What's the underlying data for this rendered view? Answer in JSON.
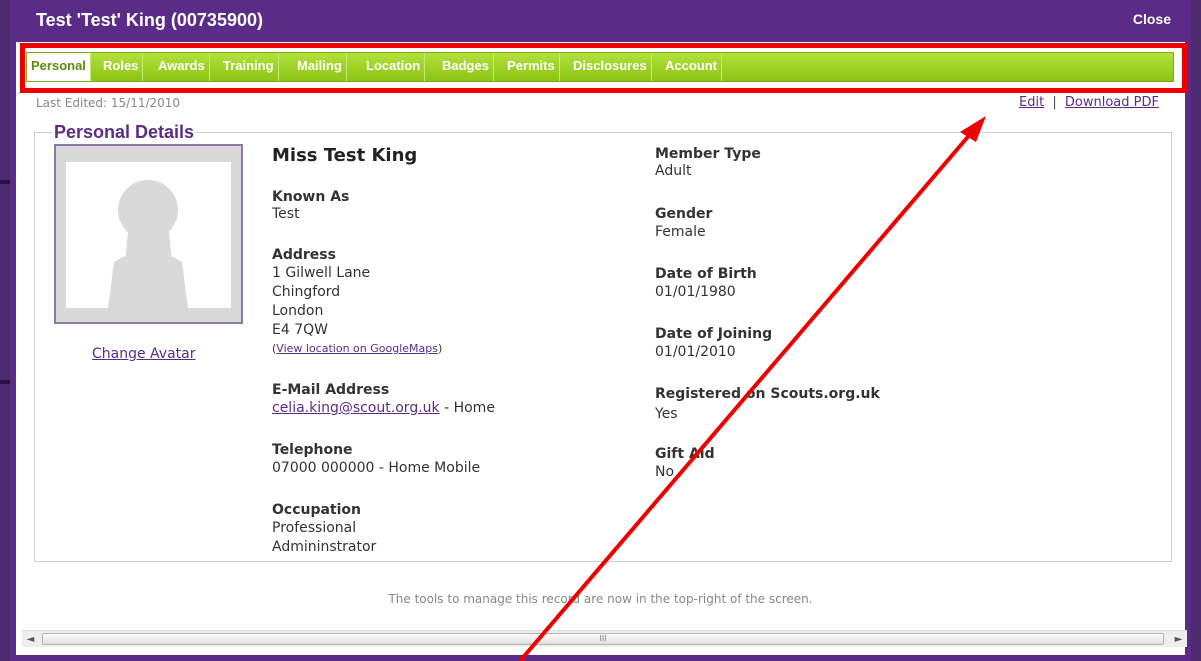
{
  "window": {
    "title": "Test 'Test' King (00735900)",
    "close_label": "Close"
  },
  "tabs": [
    {
      "label": "Personal",
      "active": true
    },
    {
      "label": "Roles"
    },
    {
      "label": "Awards"
    },
    {
      "label": "Training"
    },
    {
      "label": "Mailing"
    },
    {
      "label": "Location"
    },
    {
      "label": "Badges"
    },
    {
      "label": "Permits"
    },
    {
      "label": "Disclosures"
    },
    {
      "label": "Account"
    }
  ],
  "last_edited": "Last Edited: 15/11/2010",
  "actions": {
    "edit": "Edit",
    "separator": "|",
    "download": "Download PDF"
  },
  "section_title": "Personal Details",
  "avatar": {
    "change_label": "Change Avatar",
    "icon": "person-silhouette-icon"
  },
  "person": {
    "full_name": "Miss Test King",
    "known_as_label": "Known As",
    "known_as": "Test",
    "address_label": "Address",
    "address_lines": [
      "1 Gilwell Lane",
      "Chingford",
      "London",
      "E4 7QW"
    ],
    "map_link": "View location on GoogleMaps",
    "map_open": "(",
    "map_close": ")",
    "email_label": "E-Mail Address",
    "email": "celia.king@scout.org.uk",
    "email_type": " - Home",
    "telephone_label": "Telephone",
    "telephone": "07000 000000 - Home Mobile",
    "occupation_label": "Occupation",
    "occupation_lines": [
      "Professional",
      "Admininstrator"
    ],
    "member_type_label": "Member Type",
    "member_type": "Adult",
    "gender_label": "Gender",
    "gender": "Female",
    "dob_label": "Date of Birth",
    "dob": "01/01/1980",
    "doj_label": "Date of Joining",
    "doj": "01/01/2010",
    "registered_label": "Registered on Scouts.org.uk",
    "registered": "Yes",
    "gift_aid_label": "Gift Aid",
    "gift_aid": "No"
  },
  "footer_note": "The tools to manage this record are now in the top-right of the screen.",
  "scrollbar": {
    "left_arrow": "◄",
    "right_arrow": "►",
    "grip": "III"
  },
  "colors": {
    "header_purple": "#5b2c87",
    "tab_green": "#8cc414",
    "annotation_red": "#ef0000"
  }
}
